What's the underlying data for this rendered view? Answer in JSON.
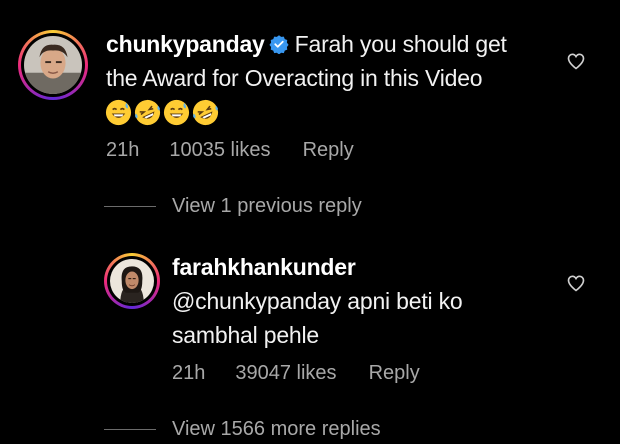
{
  "comments": [
    {
      "username": "chunkypanday",
      "verified": true,
      "text_line1": "Farah you should get",
      "text_line2": "the Award for Overacting in this Video",
      "emojis": [
        "grinning-sweat-emoji",
        "rofl-emoji",
        "grinning-sweat-emoji",
        "rofl-emoji"
      ],
      "time": "21h",
      "likes": "10035 likes",
      "reply_label": "Reply"
    },
    {
      "username": "farahkhankunder",
      "verified": false,
      "text_line1": "@chunkypanday apni beti ko",
      "text_line2": "sambhal pehle",
      "time": "21h",
      "likes": "39047 likes",
      "reply_label": "Reply"
    }
  ],
  "view_previous_reply": "View 1 previous reply",
  "view_more_replies": "View 1566 more replies",
  "colors": {
    "background": "#000000",
    "primary_text": "#f5f5f5",
    "secondary_text": "#a8a8a8",
    "verified_blue": "#3897f0",
    "emoji_yellow": "#ffcc33"
  },
  "icons": {
    "like": "heart-outline-icon",
    "verified": "verified-badge-icon"
  }
}
